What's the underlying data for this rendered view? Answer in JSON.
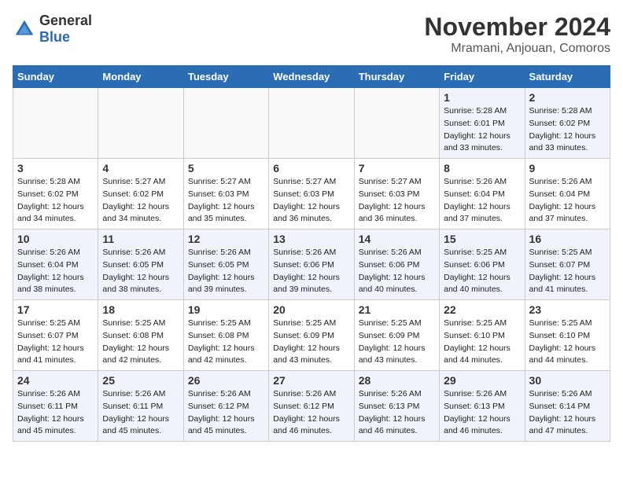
{
  "logo": {
    "general": "General",
    "blue": "Blue"
  },
  "title": "November 2024",
  "location": "Mramani, Anjouan, Comoros",
  "days_of_week": [
    "Sunday",
    "Monday",
    "Tuesday",
    "Wednesday",
    "Thursday",
    "Friday",
    "Saturday"
  ],
  "weeks": [
    [
      {
        "day": "",
        "content": ""
      },
      {
        "day": "",
        "content": ""
      },
      {
        "day": "",
        "content": ""
      },
      {
        "day": "",
        "content": ""
      },
      {
        "day": "",
        "content": ""
      },
      {
        "day": "1",
        "content": "Sunrise: 5:28 AM\nSunset: 6:01 PM\nDaylight: 12 hours and 33 minutes."
      },
      {
        "day": "2",
        "content": "Sunrise: 5:28 AM\nSunset: 6:02 PM\nDaylight: 12 hours and 33 minutes."
      }
    ],
    [
      {
        "day": "3",
        "content": "Sunrise: 5:28 AM\nSunset: 6:02 PM\nDaylight: 12 hours and 34 minutes."
      },
      {
        "day": "4",
        "content": "Sunrise: 5:27 AM\nSunset: 6:02 PM\nDaylight: 12 hours and 34 minutes."
      },
      {
        "day": "5",
        "content": "Sunrise: 5:27 AM\nSunset: 6:03 PM\nDaylight: 12 hours and 35 minutes."
      },
      {
        "day": "6",
        "content": "Sunrise: 5:27 AM\nSunset: 6:03 PM\nDaylight: 12 hours and 36 minutes."
      },
      {
        "day": "7",
        "content": "Sunrise: 5:27 AM\nSunset: 6:03 PM\nDaylight: 12 hours and 36 minutes."
      },
      {
        "day": "8",
        "content": "Sunrise: 5:26 AM\nSunset: 6:04 PM\nDaylight: 12 hours and 37 minutes."
      },
      {
        "day": "9",
        "content": "Sunrise: 5:26 AM\nSunset: 6:04 PM\nDaylight: 12 hours and 37 minutes."
      }
    ],
    [
      {
        "day": "10",
        "content": "Sunrise: 5:26 AM\nSunset: 6:04 PM\nDaylight: 12 hours and 38 minutes."
      },
      {
        "day": "11",
        "content": "Sunrise: 5:26 AM\nSunset: 6:05 PM\nDaylight: 12 hours and 38 minutes."
      },
      {
        "day": "12",
        "content": "Sunrise: 5:26 AM\nSunset: 6:05 PM\nDaylight: 12 hours and 39 minutes."
      },
      {
        "day": "13",
        "content": "Sunrise: 5:26 AM\nSunset: 6:06 PM\nDaylight: 12 hours and 39 minutes."
      },
      {
        "day": "14",
        "content": "Sunrise: 5:26 AM\nSunset: 6:06 PM\nDaylight: 12 hours and 40 minutes."
      },
      {
        "day": "15",
        "content": "Sunrise: 5:25 AM\nSunset: 6:06 PM\nDaylight: 12 hours and 40 minutes."
      },
      {
        "day": "16",
        "content": "Sunrise: 5:25 AM\nSunset: 6:07 PM\nDaylight: 12 hours and 41 minutes."
      }
    ],
    [
      {
        "day": "17",
        "content": "Sunrise: 5:25 AM\nSunset: 6:07 PM\nDaylight: 12 hours and 41 minutes."
      },
      {
        "day": "18",
        "content": "Sunrise: 5:25 AM\nSunset: 6:08 PM\nDaylight: 12 hours and 42 minutes."
      },
      {
        "day": "19",
        "content": "Sunrise: 5:25 AM\nSunset: 6:08 PM\nDaylight: 12 hours and 42 minutes."
      },
      {
        "day": "20",
        "content": "Sunrise: 5:25 AM\nSunset: 6:09 PM\nDaylight: 12 hours and 43 minutes."
      },
      {
        "day": "21",
        "content": "Sunrise: 5:25 AM\nSunset: 6:09 PM\nDaylight: 12 hours and 43 minutes."
      },
      {
        "day": "22",
        "content": "Sunrise: 5:25 AM\nSunset: 6:10 PM\nDaylight: 12 hours and 44 minutes."
      },
      {
        "day": "23",
        "content": "Sunrise: 5:25 AM\nSunset: 6:10 PM\nDaylight: 12 hours and 44 minutes."
      }
    ],
    [
      {
        "day": "24",
        "content": "Sunrise: 5:26 AM\nSunset: 6:11 PM\nDaylight: 12 hours and 45 minutes."
      },
      {
        "day": "25",
        "content": "Sunrise: 5:26 AM\nSunset: 6:11 PM\nDaylight: 12 hours and 45 minutes."
      },
      {
        "day": "26",
        "content": "Sunrise: 5:26 AM\nSunset: 6:12 PM\nDaylight: 12 hours and 45 minutes."
      },
      {
        "day": "27",
        "content": "Sunrise: 5:26 AM\nSunset: 6:12 PM\nDaylight: 12 hours and 46 minutes."
      },
      {
        "day": "28",
        "content": "Sunrise: 5:26 AM\nSunset: 6:13 PM\nDaylight: 12 hours and 46 minutes."
      },
      {
        "day": "29",
        "content": "Sunrise: 5:26 AM\nSunset: 6:13 PM\nDaylight: 12 hours and 46 minutes."
      },
      {
        "day": "30",
        "content": "Sunrise: 5:26 AM\nSunset: 6:14 PM\nDaylight: 12 hours and 47 minutes."
      }
    ]
  ]
}
